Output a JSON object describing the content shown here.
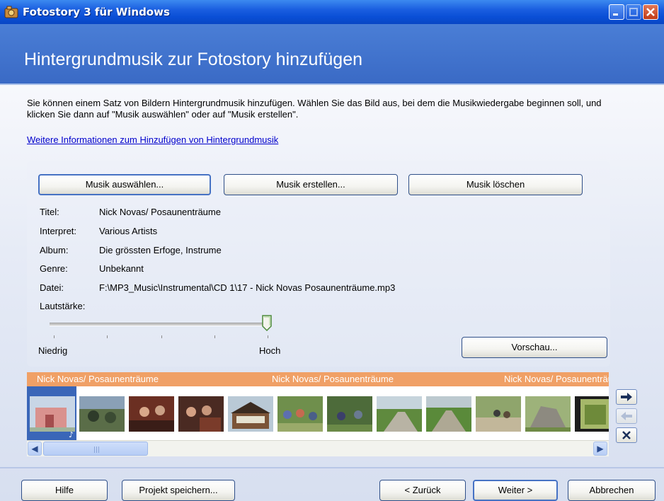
{
  "window": {
    "title": "Fotostory 3 für Windows"
  },
  "header": {
    "title": "Hintergrundmusik zur Fotostory hinzufügen"
  },
  "description": "Sie können einem Satz von Bildern Hintergrundmusik hinzufügen.  Wählen Sie das Bild aus, bei dem die Musikwiedergabe beginnen soll, und klicken Sie dann auf \"Musik auswählen\" oder auf \"Musik erstellen\".",
  "more_link": "Weitere Informationen zum Hinzufügen von Hintergrundmusik",
  "buttons": {
    "select_music": "Musik auswählen...",
    "create_music": "Musik erstellen...",
    "delete_music": "Musik löschen",
    "preview": "Vorschau...",
    "help": "Hilfe",
    "save_project": "Projekt speichern...",
    "back": "< Zurück",
    "next": "Weiter >",
    "cancel": "Abbrechen"
  },
  "info": {
    "title_label": "Titel:",
    "title_value": "Nick Novas/ Posaunenträume",
    "artist_label": "Interpret:",
    "artist_value": "Various Artists",
    "album_label": "Album:",
    "album_value": "Die grössten Erfoge, Instrume",
    "genre_label": "Genre:",
    "genre_value": "Unbekannt",
    "file_label": "Datei:",
    "file_value": "F:\\MP3_Music\\Instrumental\\CD 1\\17 - Nick Novas Posaunenträume.mp3",
    "volume_label": "Lautstärke:"
  },
  "volume": {
    "min_label": "Niedrig",
    "max_label": "Hoch",
    "level": 1.0
  },
  "timeline": {
    "music_labels": [
      "Nick Novas/ Posaunenträume",
      "Nick Novas/ Posaunenträume",
      "Nick Novas/ Posaunenträume"
    ],
    "selected_index": 0
  },
  "colors": {
    "accent": "#3a6ac5",
    "music_strip": "#f0a066",
    "selection": "#3a66b8"
  }
}
